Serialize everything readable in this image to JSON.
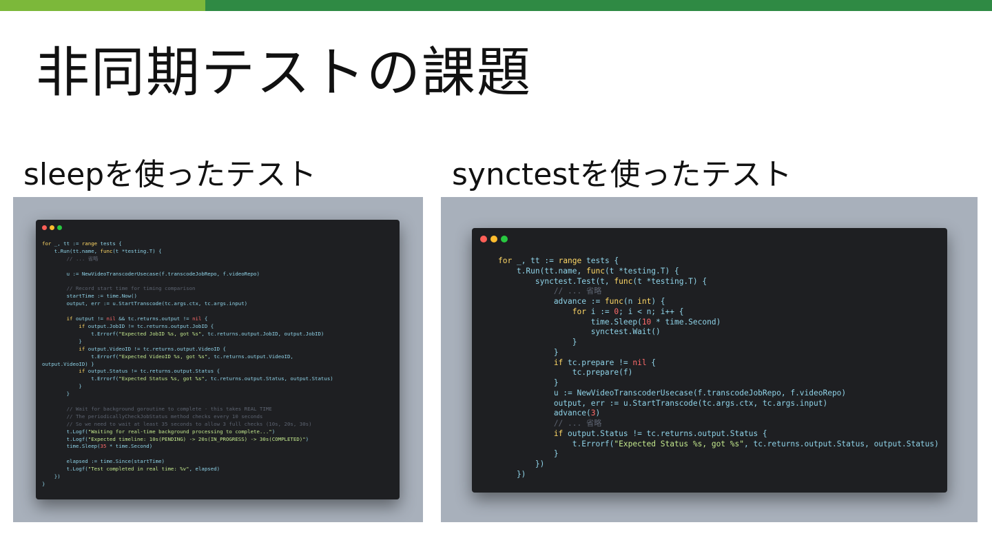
{
  "colors": {
    "topbar_light": "#7cb83a",
    "topbar_dark": "#2f8a44",
    "dot_red": "#ff5f57",
    "dot_yellow": "#febc2e",
    "dot_green": "#28c840"
  },
  "slide": {
    "title": "非同期テストの課題"
  },
  "left": {
    "subtitle": "sleepを使ったテスト",
    "code_lines": [
      [
        [
          "kw",
          "for"
        ],
        [
          "pl",
          " _, tt := "
        ],
        [
          "kw",
          "range"
        ],
        [
          "pl",
          " tests {"
        ]
      ],
      [
        [
          "pl",
          "    t.Run(tt.name, "
        ],
        [
          "kw",
          "func"
        ],
        [
          "pl",
          "(t *testing.T) {"
        ]
      ],
      [
        [
          "cm",
          "        // ... 省略"
        ]
      ],
      [
        [
          "pl",
          ""
        ]
      ],
      [
        [
          "pl",
          "        u := NewVideoTranscoderUsecase(f.transcodeJobRepo, f.videoRepo)"
        ]
      ],
      [
        [
          "pl",
          ""
        ]
      ],
      [
        [
          "cm",
          "        // Record start time for timing comparison"
        ]
      ],
      [
        [
          "pl",
          "        startTime := time.Now()"
        ]
      ],
      [
        [
          "pl",
          "        output, err := u.StartTranscode(tc.args.ctx, tc.args.input)"
        ]
      ],
      [
        [
          "pl",
          ""
        ]
      ],
      [
        [
          "kw",
          "        if"
        ],
        [
          "pl",
          " output != "
        ],
        [
          "nil",
          "nil"
        ],
        [
          "pl",
          " && tc.returns.output != "
        ],
        [
          "nil",
          "nil"
        ],
        [
          "pl",
          " {"
        ]
      ],
      [
        [
          "kw",
          "            if"
        ],
        [
          "pl",
          " output.JobID != tc.returns.output.JobID {"
        ]
      ],
      [
        [
          "pl",
          "                t.Errorf("
        ],
        [
          "str",
          "\"Expected JobID %s, got %s\""
        ],
        [
          "pl",
          ", tc.returns.output.JobID, output.JobID)"
        ]
      ],
      [
        [
          "pl",
          "            }"
        ]
      ],
      [
        [
          "kw",
          "            if"
        ],
        [
          "pl",
          " output.VideoID != tc.returns.output.VideoID {"
        ]
      ],
      [
        [
          "pl",
          "                t.Errorf("
        ],
        [
          "str",
          "\"Expected VideoID %s, got %s\""
        ],
        [
          "pl",
          ", tc.returns.output.VideoID,"
        ]
      ],
      [
        [
          "pl",
          "output.VideoID) }"
        ]
      ],
      [
        [
          "kw",
          "            if"
        ],
        [
          "pl",
          " output.Status != tc.returns.output.Status {"
        ]
      ],
      [
        [
          "pl",
          "                t.Errorf("
        ],
        [
          "str",
          "\"Expected Status %s, got %s\""
        ],
        [
          "pl",
          ", tc.returns.output.Status, output.Status)"
        ]
      ],
      [
        [
          "pl",
          "            }"
        ]
      ],
      [
        [
          "pl",
          "        }"
        ]
      ],
      [
        [
          "pl",
          ""
        ]
      ],
      [
        [
          "cm",
          "        // Wait for background goroutine to complete - this takes REAL TIME"
        ]
      ],
      [
        [
          "cm",
          "        // The periodicallyCheckJobStatus method checks every 10 seconds"
        ]
      ],
      [
        [
          "cm",
          "        // So we need to wait at least 35 seconds to allow 3 full checks (10s, 20s, 30s)"
        ]
      ],
      [
        [
          "pl",
          "        t.Logf("
        ],
        [
          "str",
          "\"Waiting for real-time background processing to complete...\""
        ],
        [
          "pl",
          ")"
        ]
      ],
      [
        [
          "pl",
          "        t.Logf("
        ],
        [
          "str",
          "\"Expected timeline: 10s(PENDING) -> 20s(IN_PROGRESS) -> 30s(COMPLETED)\""
        ],
        [
          "pl",
          ")"
        ]
      ],
      [
        [
          "pl",
          "        time.Sleep("
        ],
        [
          "num",
          "35"
        ],
        [
          "pl",
          " * time.Second)"
        ]
      ],
      [
        [
          "pl",
          ""
        ]
      ],
      [
        [
          "pl",
          "        elapsed := time.Since(startTime)"
        ]
      ],
      [
        [
          "pl",
          "        t.Logf("
        ],
        [
          "str",
          "\"Test completed in real time: %v\""
        ],
        [
          "pl",
          ", elapsed)"
        ]
      ],
      [
        [
          "pl",
          "    })"
        ]
      ],
      [
        [
          "pl",
          "}"
        ]
      ]
    ]
  },
  "right": {
    "subtitle": "synctestを使ったテスト",
    "code_lines": [
      [
        [
          "kw",
          "for"
        ],
        [
          "pl",
          " _, tt := "
        ],
        [
          "kw",
          "range"
        ],
        [
          "pl",
          " tests {"
        ]
      ],
      [
        [
          "pl",
          "    t.Run(tt.name, "
        ],
        [
          "kw",
          "func"
        ],
        [
          "pl",
          "(t *testing.T) {"
        ]
      ],
      [
        [
          "pl",
          "        synctest.Test(t, "
        ],
        [
          "kw",
          "func"
        ],
        [
          "pl",
          "(t *testing.T) {"
        ]
      ],
      [
        [
          "cm",
          "            // ... 省略"
        ]
      ],
      [
        [
          "pl",
          "            advance := "
        ],
        [
          "kw",
          "func"
        ],
        [
          "pl",
          "(n "
        ],
        [
          "kw",
          "int"
        ],
        [
          "pl",
          ") {"
        ]
      ],
      [
        [
          "kw",
          "                for"
        ],
        [
          "pl",
          " i := "
        ],
        [
          "num",
          "0"
        ],
        [
          "pl",
          "; i < n; i++ {"
        ]
      ],
      [
        [
          "pl",
          "                    time.Sleep("
        ],
        [
          "num",
          "10"
        ],
        [
          "pl",
          " * time.Second)"
        ]
      ],
      [
        [
          "pl",
          "                    synctest.Wait()"
        ]
      ],
      [
        [
          "pl",
          "                }"
        ]
      ],
      [
        [
          "pl",
          "            }"
        ]
      ],
      [
        [
          "kw",
          "            if"
        ],
        [
          "pl",
          " tc.prepare != "
        ],
        [
          "nil",
          "nil"
        ],
        [
          "pl",
          " {"
        ]
      ],
      [
        [
          "pl",
          "                tc.prepare(f)"
        ]
      ],
      [
        [
          "pl",
          "            }"
        ]
      ],
      [
        [
          "pl",
          "            u := NewVideoTranscoderUsecase(f.transcodeJobRepo, f.videoRepo)"
        ]
      ],
      [
        [
          "pl",
          "            output, err := u.StartTranscode(tc.args.ctx, tc.args.input)"
        ]
      ],
      [
        [
          "pl",
          "            advance("
        ],
        [
          "num",
          "3"
        ],
        [
          "pl",
          ")"
        ]
      ],
      [
        [
          "cm",
          "            // ... 省略"
        ]
      ],
      [
        [
          "kw",
          "            if"
        ],
        [
          "pl",
          " output.Status != tc.returns.output.Status {"
        ]
      ],
      [
        [
          "pl",
          "                t.Errorf("
        ],
        [
          "str",
          "\"Expected Status %s, got %s\""
        ],
        [
          "pl",
          ", tc.returns.output.Status, output.Status)"
        ]
      ],
      [
        [
          "pl",
          "            }"
        ]
      ],
      [
        [
          "pl",
          "        })"
        ]
      ],
      [
        [
          "pl",
          "    })"
        ]
      ]
    ]
  }
}
